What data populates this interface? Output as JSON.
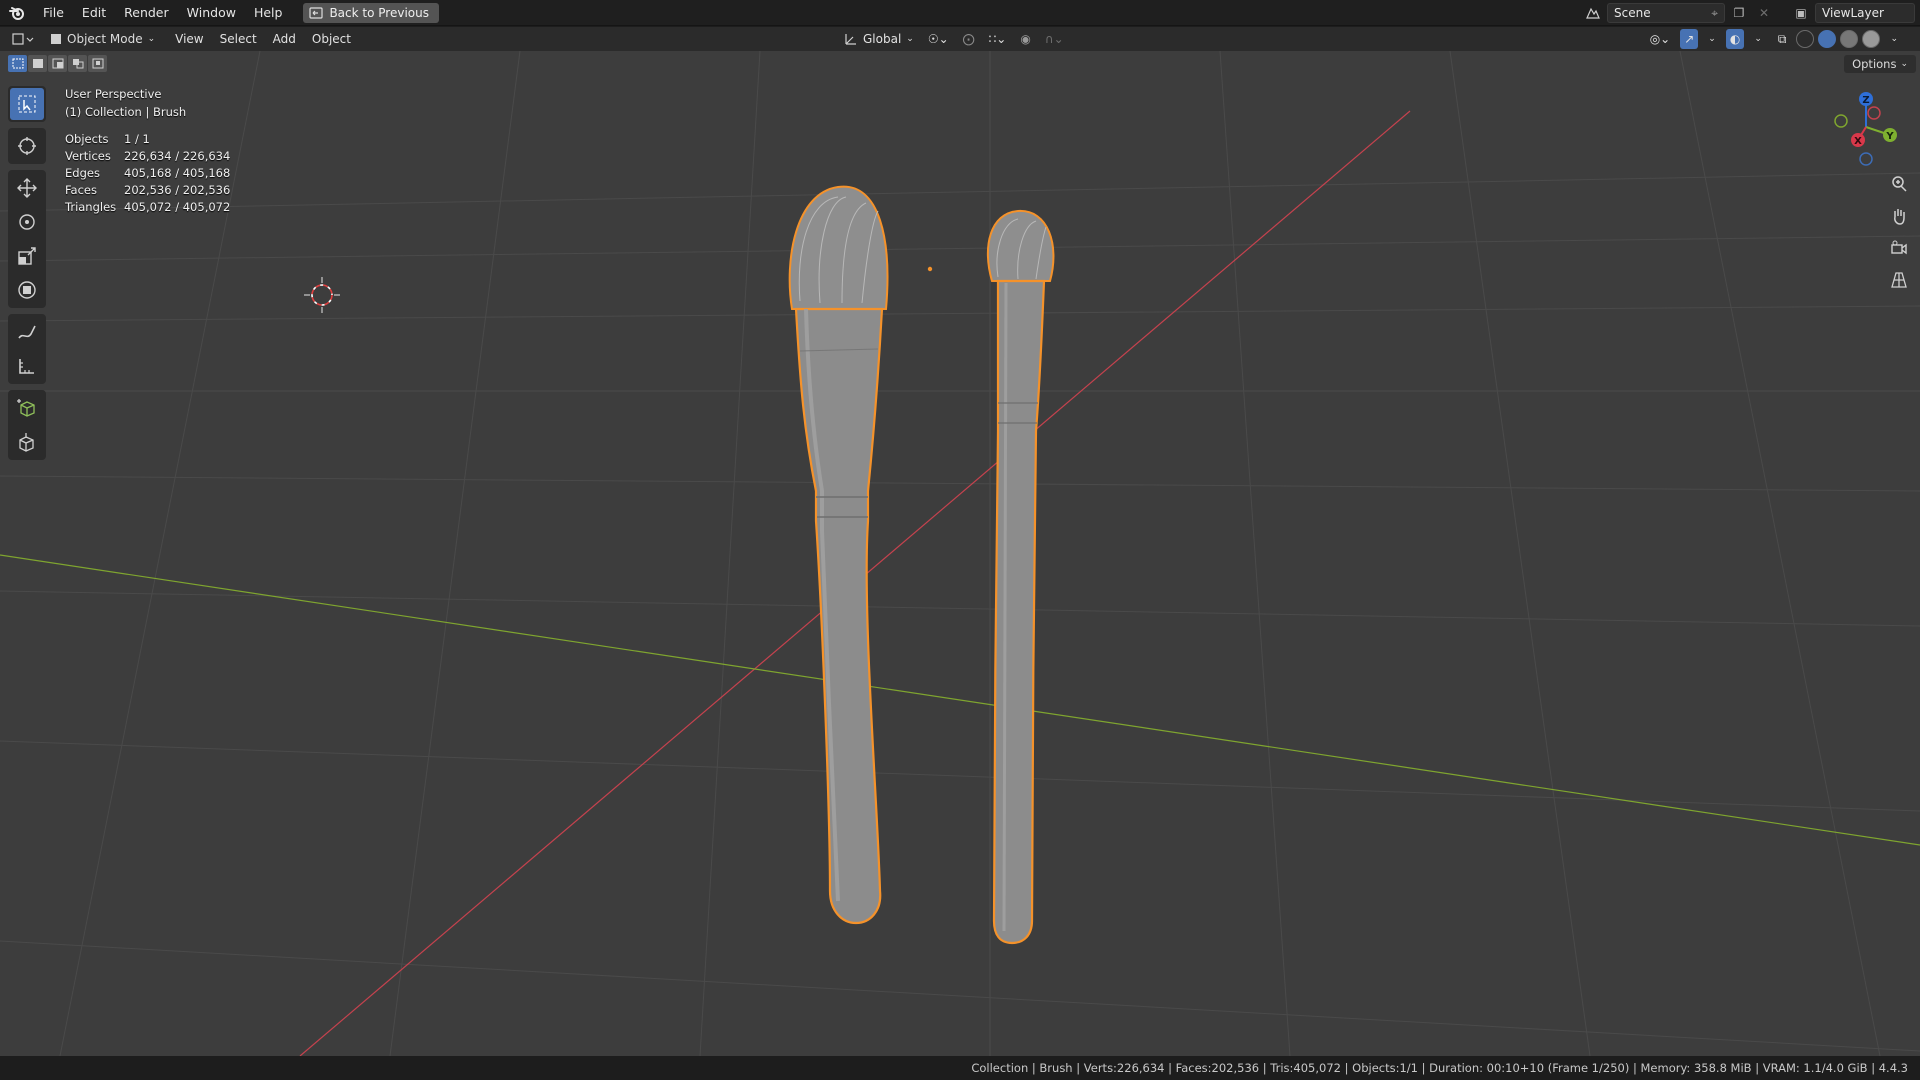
{
  "menu": {
    "items": [
      "File",
      "Edit",
      "Render",
      "Window",
      "Help"
    ],
    "back_button": "Back to Previous"
  },
  "scene": {
    "name": "Scene",
    "view_layer": "ViewLayer"
  },
  "viewport_header": {
    "mode": "Object Mode",
    "menus": [
      "View",
      "Select",
      "Add",
      "Object"
    ],
    "transform_orientation": "Global",
    "options": "Options"
  },
  "overlay": {
    "view_name": "User Perspective",
    "collection": "(1) Collection | Brush"
  },
  "stats": [
    {
      "label": "Objects",
      "value": "1 / 1"
    },
    {
      "label": "Vertices",
      "value": "226,634 / 226,634"
    },
    {
      "label": "Edges",
      "value": "405,168 / 405,168"
    },
    {
      "label": "Faces",
      "value": "202,536 / 202,536"
    },
    {
      "label": "Triangles",
      "value": "405,072 / 405,072"
    }
  ],
  "gizmo": {
    "z": "Z",
    "y": "Y",
    "x": "X"
  },
  "status_bar": "Collection | Brush | Verts:226,634 | Faces:202,536 | Tris:405,072 | Objects:1/1 | Duration: 00:10+10 (Frame 1/250) | Memory: 358.8 MiB | VRAM: 1.1/4.0 GiB | 4.4.3",
  "colors": {
    "accent": "#4772b3",
    "selection_outline": "#f5922a",
    "axis_x": "#c4424e",
    "axis_y": "#7fa52f",
    "viewport_bg": "#3d3d3d"
  }
}
